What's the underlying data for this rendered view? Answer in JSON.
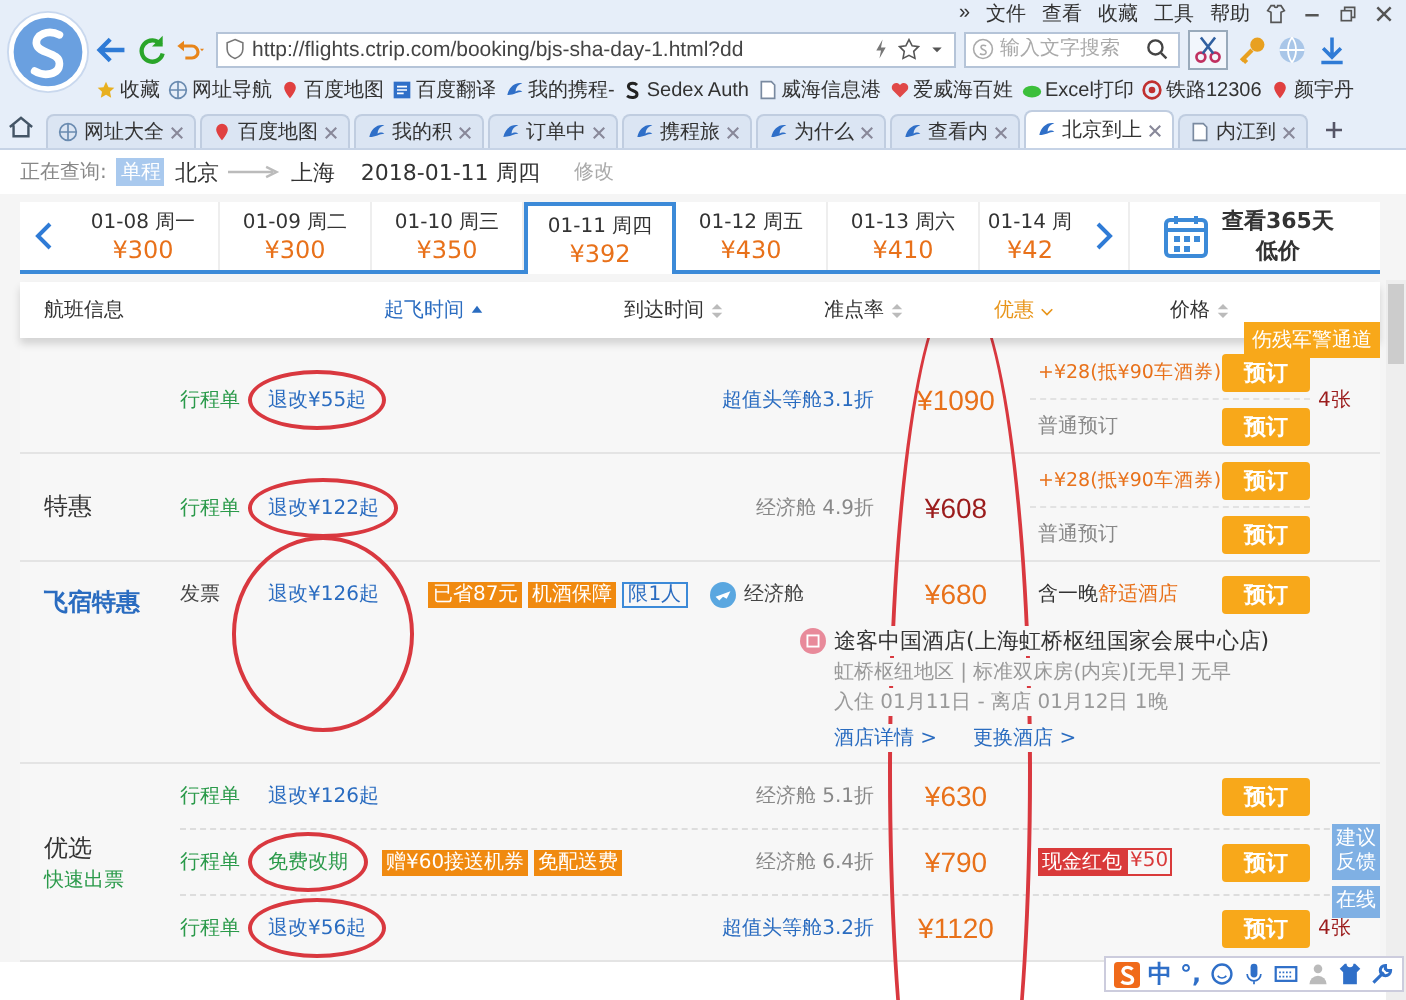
{
  "browser": {
    "menu": [
      "»",
      "文件",
      "查看",
      "收藏",
      "工具",
      "帮助"
    ],
    "url": "http://flights.ctrip.com/booking/bjs-sha-day-1.html?dd",
    "search_placeholder": "输入文字搜索",
    "bookmarks": [
      "收藏",
      "网址导航",
      "百度地图",
      "百度翻译",
      "我的携程-",
      "Sedex Auth",
      "威海信息港",
      "爱威海百姓",
      "Excel打印",
      "铁路12306",
      "颜宇丹"
    ],
    "tabs": [
      {
        "label": "网址大全",
        "selected": false
      },
      {
        "label": "百度地图",
        "selected": false
      },
      {
        "label": "我的积",
        "selected": false
      },
      {
        "label": "订单中",
        "selected": false
      },
      {
        "label": "携程旅",
        "selected": false
      },
      {
        "label": "为什么",
        "selected": false
      },
      {
        "label": "查看内",
        "selected": false
      },
      {
        "label": "北京到上",
        "selected": true
      },
      {
        "label": "内江到",
        "selected": false
      }
    ]
  },
  "query": {
    "label": "正在查询:",
    "trip_type": "单程",
    "from": "北京",
    "to": "上海",
    "date": "2018-01-11 周四",
    "edit": "修改"
  },
  "dates": [
    {
      "date": "01-08 周一",
      "price": "¥300",
      "selected": false
    },
    {
      "date": "01-09 周二",
      "price": "¥300",
      "selected": false
    },
    {
      "date": "01-10 周三",
      "price": "¥350",
      "selected": false
    },
    {
      "date": "01-11 周四",
      "price": "¥392",
      "selected": true
    },
    {
      "date": "01-12 周五",
      "price": "¥430",
      "selected": false
    },
    {
      "date": "01-13 周六",
      "price": "¥410",
      "selected": false
    },
    {
      "date": "01-14 周",
      "price": "¥42",
      "selected": false
    }
  ],
  "calendar_link": {
    "line1": "查看365天",
    "line2": "低价"
  },
  "columns": [
    {
      "label": "航班信息",
      "kind": "plain",
      "selected": false
    },
    {
      "label": "起飞时间",
      "kind": "sort",
      "selected": true
    },
    {
      "label": "到达时间",
      "kind": "sort",
      "selected": false
    },
    {
      "label": "准点率",
      "kind": "sort",
      "selected": false
    },
    {
      "label": "优惠",
      "kind": "filter",
      "selected": false
    },
    {
      "label": "价格",
      "kind": "sort",
      "selected": false
    }
  ],
  "special_button": "伤残军警通道",
  "price_column_circled": true,
  "groups": [
    {
      "kind": "flight",
      "lines": [
        {
          "doc": "行程单",
          "refund": "退改¥55起",
          "circled": true,
          "free": false,
          "cabin": "超值头等舱3.1折",
          "premium": true,
          "price": "¥1090",
          "color": "#e8711a",
          "offers": [
            {
              "kind": "promo",
              "text": "+¥28(抵¥90车酒券)",
              "button": "预订"
            },
            {
              "kind": "plain",
              "text": "普通预订",
              "button": "预订"
            }
          ],
          "extra": "4张"
        }
      ]
    },
    {
      "kind": "flight",
      "label": "特惠",
      "lines": [
        {
          "doc": "行程单",
          "refund": "退改¥122起",
          "circled": true,
          "free": false,
          "cabin": "经济舱 4.9折",
          "premium": false,
          "price": "¥608",
          "color": "#9b1c1c",
          "offers": [
            {
              "kind": "promo",
              "text": "+¥28(抵¥90车酒券)",
              "button": "预订"
            },
            {
              "kind": "plain",
              "text": "普通预订",
              "button": "预订"
            }
          ]
        }
      ]
    },
    {
      "kind": "package",
      "label": "飞宿特惠",
      "doc": "发票",
      "refund": "退改¥126起",
      "circled": true,
      "tags": [
        {
          "text": "已省87元",
          "kind": "filled"
        },
        {
          "text": "机酒保障",
          "kind": "filled"
        },
        {
          "text": "限1人",
          "kind": "outline"
        }
      ],
      "cabin": "经济舱",
      "price": "¥680",
      "includes": "含一晚",
      "hotel_type": "舒适酒店",
      "button": "预订",
      "hotel": {
        "name": "途客中国酒店(上海虹桥枢纽国家会展中心店)",
        "detail": "虹桥枢纽地区 | 标准双床房(内宾)[无早] 无早",
        "stay": "入住 01月11日 - 离店 01月12日 1晚",
        "links": [
          "酒店详情 >",
          "更换酒店 >"
        ]
      }
    },
    {
      "kind": "flight",
      "label": "优选",
      "sublabel": "快速出票",
      "lines": [
        {
          "doc": "行程单",
          "refund": "退改¥126起",
          "free": false,
          "cabin": "经济舱 5.1折",
          "premium": false,
          "price": "¥630",
          "color": "#e8711a",
          "offers": [
            {
              "kind": "button",
              "button": "预订"
            }
          ]
        },
        {
          "doc": "行程单",
          "refund": "免费改期",
          "circled": true,
          "free": true,
          "tags": [
            {
              "text": "赠¥60接送机券",
              "kind": "filled"
            },
            {
              "text": "免配送费",
              "kind": "filled"
            }
          ],
          "cabin": "经济舱 6.4折",
          "premium": false,
          "price": "¥790",
          "color": "#e8711a",
          "bonus": {
            "label": "现金红包",
            "amount": "¥50"
          },
          "offers": [
            {
              "kind": "button",
              "button": "预订"
            }
          ]
        },
        {
          "doc": "行程单",
          "refund": "退改¥56起",
          "circled": true,
          "free": false,
          "cabin": "超值头等舱3.2折",
          "premium": true,
          "price": "¥1120",
          "color": "#e8711a",
          "offers": [
            {
              "kind": "button",
              "button": "预订"
            }
          ],
          "extra": "4张"
        }
      ]
    }
  ],
  "feedback": {
    "label": "建议反馈",
    "online": "在线"
  },
  "ime": {
    "mode": "中",
    "punct": "°,"
  }
}
